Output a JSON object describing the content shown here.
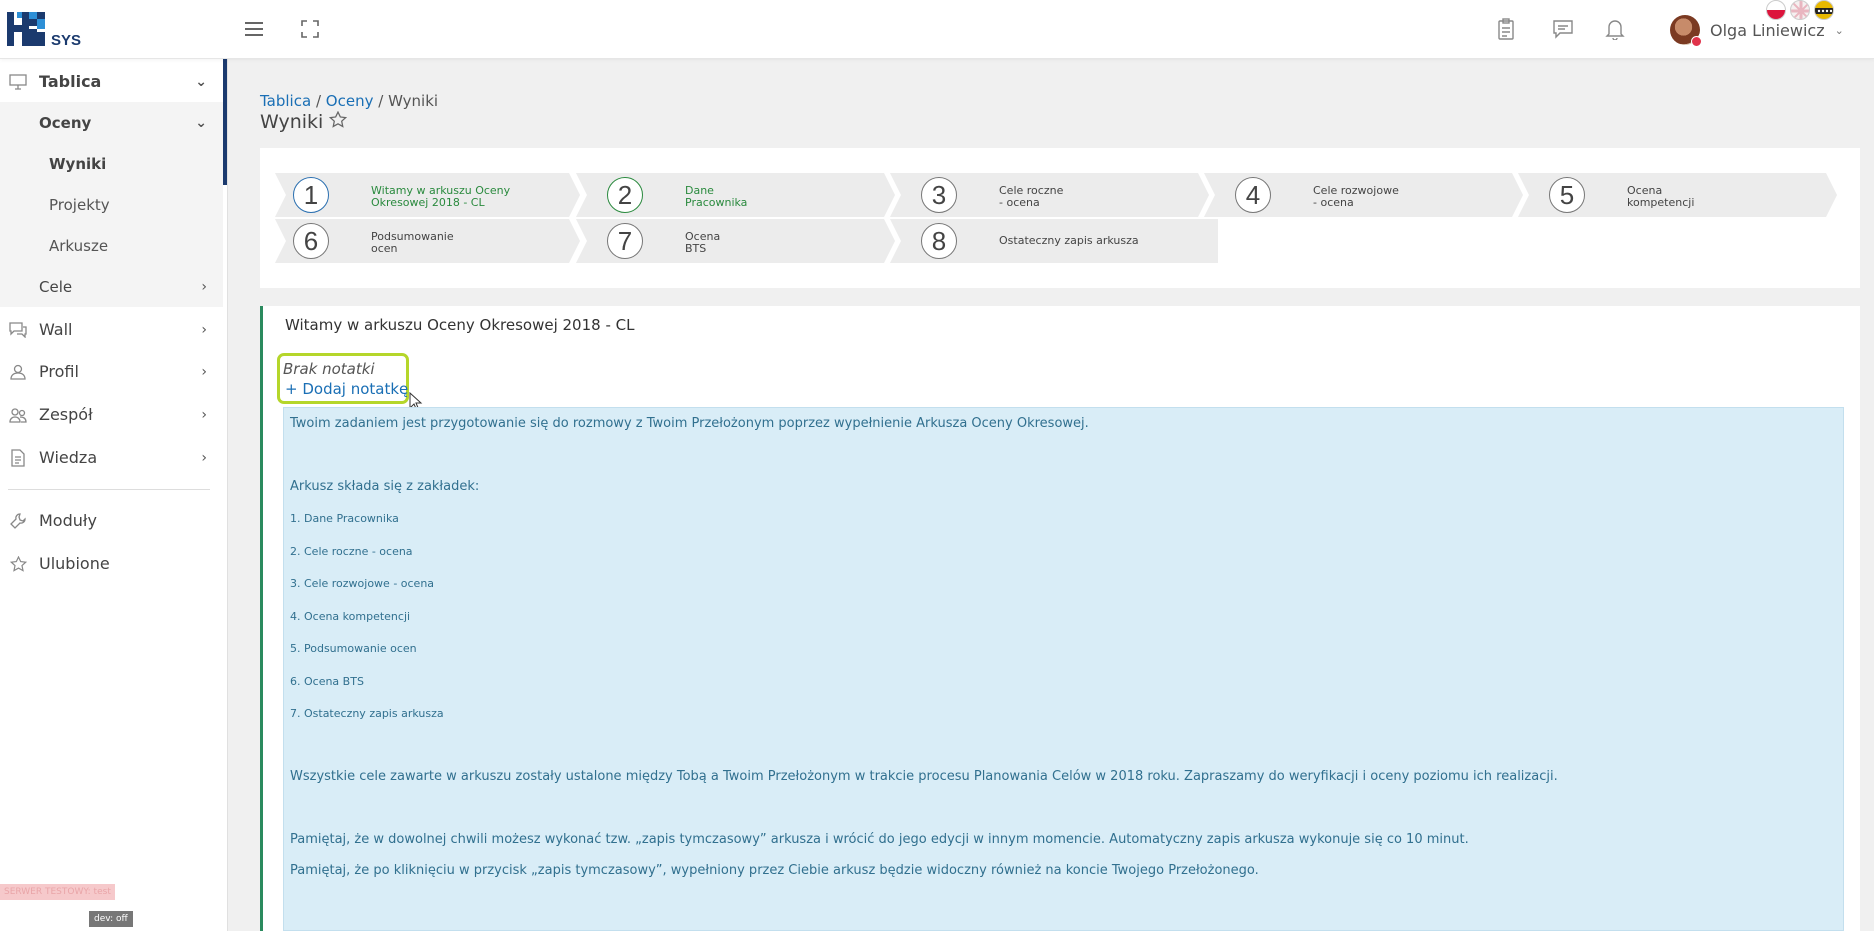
{
  "app": {
    "logo_text": "HR",
    "logo_sub": "SYS"
  },
  "user": {
    "name": "Olga Liniewicz"
  },
  "sidebar": {
    "items": [
      {
        "label": "Tablica",
        "icon": "monitor-icon"
      },
      {
        "label": "Oceny"
      },
      {
        "label": "Wyniki"
      },
      {
        "label": "Projekty"
      },
      {
        "label": "Arkusze"
      },
      {
        "label": "Cele"
      },
      {
        "label": "Wall",
        "icon": "chat-icon"
      },
      {
        "label": "Profil",
        "icon": "user-icon"
      },
      {
        "label": "Zespół",
        "icon": "team-icon"
      },
      {
        "label": "Wiedza",
        "icon": "document-icon"
      },
      {
        "label": "Moduły",
        "icon": "wrench-icon"
      },
      {
        "label": "Ulubione",
        "icon": "star-icon"
      }
    ],
    "server_badge": "SERWER TESTOWY: test",
    "dev_badge": "dev: off"
  },
  "breadcrumb": {
    "items": [
      "Tablica",
      "Oceny",
      "Wyniki"
    ],
    "sep": "/"
  },
  "page": {
    "title": "Wyniki"
  },
  "steps": [
    {
      "num": "1",
      "label": "Witamy w arkuszu Oceny\nOkresowej 2018 - CL"
    },
    {
      "num": "2",
      "label": "Dane\nPracownika"
    },
    {
      "num": "3",
      "label": "Cele roczne\n- ocena"
    },
    {
      "num": "4",
      "label": "Cele rozwojowe\n- ocena"
    },
    {
      "num": "5",
      "label": "Ocena\nkompetencji"
    },
    {
      "num": "6",
      "label": "Podsumowanie\nocen"
    },
    {
      "num": "7",
      "label": "Ocena\nBTS"
    },
    {
      "num": "8",
      "label": "Ostateczny zapis arkusza"
    }
  ],
  "section": {
    "title": "Witamy w arkuszu Oceny Okresowej 2018 - CL",
    "note_empty": "Brak notatki",
    "note_add": "+  Dodaj notatkę"
  },
  "info": {
    "intro": "Twoim zadaniem jest przygotowanie się do rozmowy z Twoim Przełożonym poprzez wypełnienie Arkusza Oceny Okresowej.",
    "tabs_heading": "Arkusz składa się z zakładek:",
    "tabs": [
      "1. Dane Pracownika",
      "2. Cele roczne - ocena",
      "3. Cele rozwojowe - ocena",
      "4. Ocena kompetencji",
      "5. Podsumowanie ocen",
      "6. Ocena BTS",
      "7. Ostateczny zapis arkusza"
    ],
    "p1": "Wszystkie cele zawarte w arkuszu zostały ustalone między Tobą a Twoim Przełożonym w trakcie procesu Planowania Celów w 2018 roku. Zapraszamy do weryfikacji i oceny poziomu ich realizacji.",
    "p2": "Pamiętaj, że w dowolnej chwili możesz wykonać tzw. „zapis tymczasowy” arkusza i wrócić do jego edycji w innym momencie. Automatyczny zapis arkusza wykonuje się co 10 minut.",
    "p3": "Pamiętaj, że po kliknięciu w przycisk „zapis tymczasowy”, wypełniony przez Ciebie arkusz będzie widoczny również na koncie Twojego Przełożonego."
  }
}
